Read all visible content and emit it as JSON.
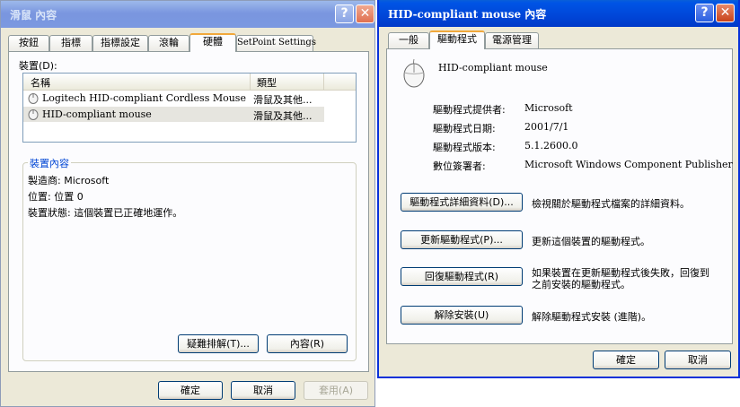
{
  "left_dialog": {
    "title": "滑鼠 內容",
    "tabs": [
      "按鈕",
      "指標",
      "指標設定",
      "滾輪",
      "硬體",
      "SetPoint Settings"
    ],
    "devices_label": "裝置(D):",
    "list": {
      "columns": [
        "名稱",
        "類型"
      ],
      "rows": [
        {
          "name": "Logitech HID-compliant Cordless Mouse",
          "type": "滑鼠及其他..."
        },
        {
          "name": "HID-compliant mouse",
          "type": "滑鼠及其他..."
        }
      ]
    },
    "properties_group": {
      "title": "裝置內容",
      "manufacturer": "製造商:  Microsoft",
      "location": "位置: 位置 0",
      "status": "裝置狀態: 這個裝置已正確地運作。"
    },
    "troubleshoot_button": "疑難排解(T)...",
    "properties_button": "內容(R)",
    "ok_button": "確定",
    "cancel_button": "取消",
    "apply_button": "套用(A)"
  },
  "right_dialog": {
    "title": "HID-compliant mouse 內容",
    "tabs": [
      "一般",
      "驅動程式",
      "電源管理"
    ],
    "device_name": "HID-compliant mouse",
    "info": [
      {
        "label": "驅動程式提供者:",
        "value": "Microsoft"
      },
      {
        "label": "驅動程式日期:",
        "value": "2001/7/1"
      },
      {
        "label": "驅動程式版本:",
        "value": "5.1.2600.0"
      },
      {
        "label": "數位簽署者:",
        "value": "Microsoft Windows Component Publisher"
      }
    ],
    "actions": [
      {
        "button": "驅動程式詳細資料(D)...",
        "desc": "檢視關於驅動程式檔案的詳細資料。"
      },
      {
        "button": "更新驅動程式(P)...",
        "desc": "更新這個裝置的驅動程式。"
      },
      {
        "button": "回復驅動程式(R)",
        "desc_line1": "如果裝置在更新驅動程式後失敗，回復到",
        "desc_line2": "之前安裝的驅動程式。"
      },
      {
        "button": "解除安裝(U)",
        "desc": "解除驅動程式安裝 (進階)。"
      }
    ],
    "ok_button": "確定",
    "cancel_button": "取消"
  },
  "caption": {
    "help": "?",
    "close": "✕"
  },
  "icons": [
    "mouse-icon",
    "help-icon",
    "close-icon"
  ],
  "colors": {
    "active_title": "#0046d8",
    "inactive_title": "#7a96df",
    "tab_highlight": "#f1a83b",
    "dialog_face": "#ece9d8",
    "group_title": "#0046d5"
  }
}
